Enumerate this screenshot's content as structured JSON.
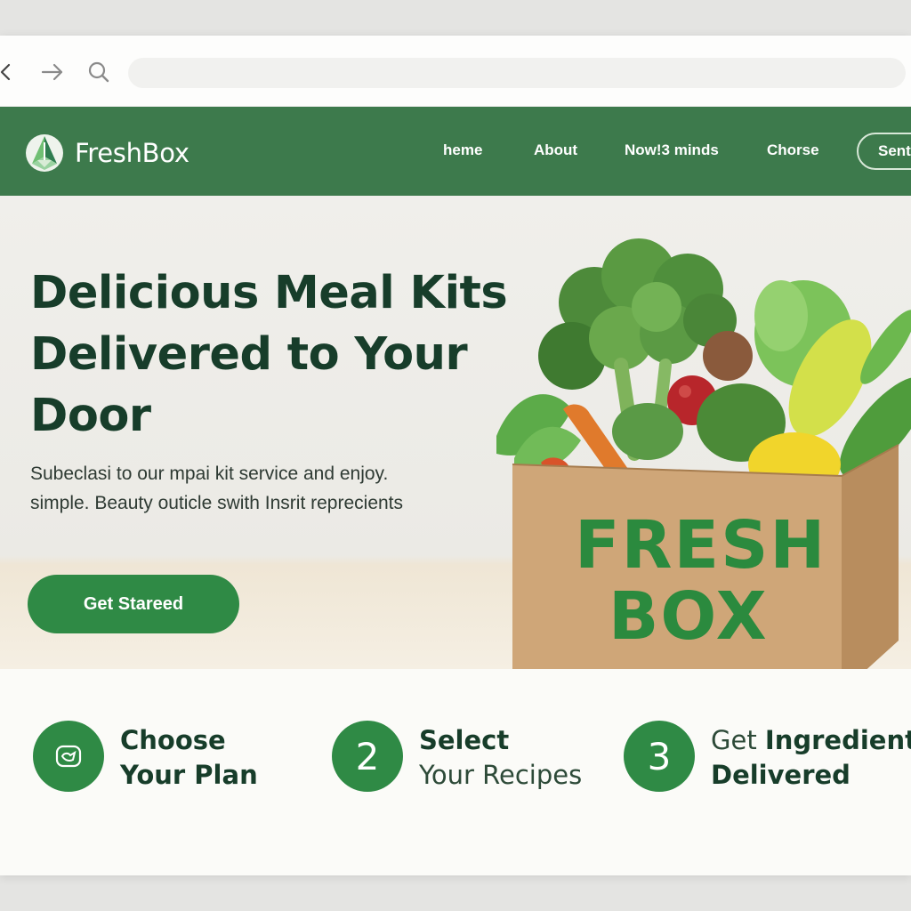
{
  "browser": {
    "address_value": "",
    "icons": [
      "back-arrow-icon",
      "forward-arrow-icon",
      "search-icon"
    ]
  },
  "header": {
    "brand": "FreshBox",
    "nav": [
      "heme",
      "About",
      "Now!3 minds",
      "Chorse"
    ],
    "cta": "Sent"
  },
  "hero": {
    "title": "Delicious Meal Kits Delivered to Your Door",
    "subtitle_line1": "Subeclasi to our mpai kit service and enjoy.",
    "subtitle_line2": "simple. Beauty outicle swith Insrit reprecients",
    "cta": "Get Stareed",
    "box_line1": "FRESH",
    "box_line2": "BOX"
  },
  "steps": [
    {
      "number": "",
      "icon": "plan-icon",
      "line1": "Choose",
      "line2": "Your Plan"
    },
    {
      "number": "2",
      "line1": "Select",
      "line2": "Your Recipes"
    },
    {
      "number": "3",
      "line1_light": "Get ",
      "line1_strong": "Ingredients",
      "line2": "Delivered"
    }
  ],
  "colors": {
    "header_green": "#3d7a4c",
    "button_green": "#2f8a45",
    "title_dark": "#173d2a",
    "box_kraft": "#cfa678",
    "box_text_green": "#2b8a3e"
  }
}
